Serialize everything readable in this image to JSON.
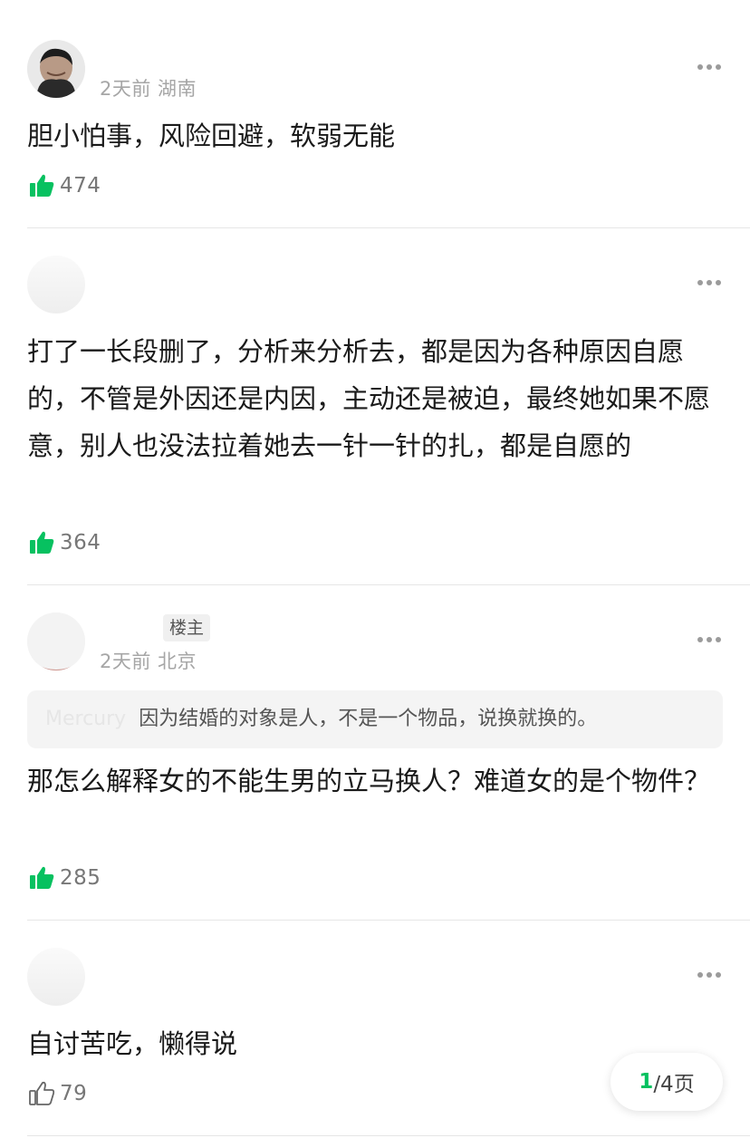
{
  "colors": {
    "accent_green": "#07c160",
    "text": "#1a1a1a",
    "meta": "#a6a6a6",
    "divider": "#e6e6e6"
  },
  "comments": [
    {
      "username": "",
      "meta": "2天前 湖南",
      "text": "胆小怕事，风险回避，软弱无能",
      "likes": "474",
      "liked": true
    },
    {
      "username": "",
      "meta": "",
      "text": "打了一长段删了，分析来分析去，都是因为各种原因自愿的，不管是外因还是内因，主动还是被迫，最终她如果不愿意，别人也没法拉着她去一针一针的扎，都是自愿的",
      "likes": "364",
      "liked": true
    },
    {
      "username": "",
      "badge": "楼主",
      "meta": "2天前 北京",
      "quote_name": "Mercury",
      "quote_text": "因为结婚的对象是人，不是一个物品，说换就换的。",
      "text": "那怎么解释女的不能生男的立马换人？难道女的是个物件？",
      "likes": "285",
      "liked": true
    },
    {
      "username": "",
      "meta": "",
      "text": "自讨苦吃，懒得说",
      "likes": "79",
      "liked": false
    }
  ],
  "pager": {
    "current": "1",
    "total_label": "/4页"
  }
}
